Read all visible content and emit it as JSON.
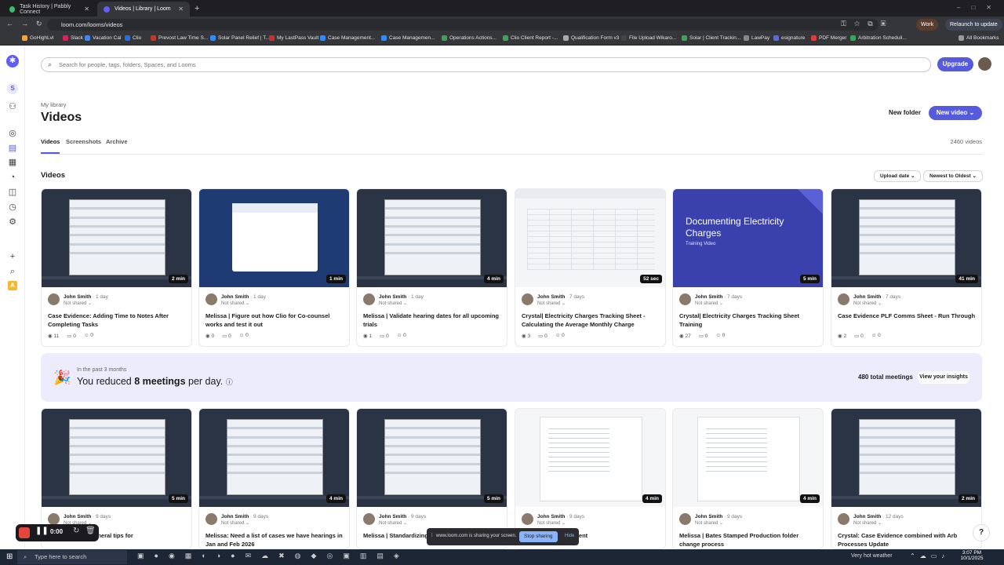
{
  "browser": {
    "tabs": [
      {
        "title": "Task History | Pabbly Connect",
        "color": "#3cba6f"
      },
      {
        "title": "Videos | Library | Loom",
        "color": "#625df5"
      }
    ],
    "url": "loom.com/looms/videos",
    "profile": "Work",
    "relaunch": "Relaunch to update",
    "bookmarks": [
      {
        "label": "GoHighLvl",
        "color": "#f2a53b"
      },
      {
        "label": "Slack",
        "color": "#e01e5a"
      },
      {
        "label": "Vacation Cal",
        "color": "#4285f4"
      },
      {
        "label": "Clio",
        "color": "#1a73e8"
      },
      {
        "label": "Prevost Law Time S...",
        "color": "#c0392b"
      },
      {
        "label": "Solar Panel Relief | T...",
        "color": "#2d8cff"
      },
      {
        "label": "My LastPass Vault",
        "color": "#d32d27"
      },
      {
        "label": "Case Management...",
        "color": "#2d8cff"
      },
      {
        "label": "Case Managemen...",
        "color": "#2d8cff"
      },
      {
        "label": "Operations Actions...",
        "color": "#34a853"
      },
      {
        "label": "Clio Client Report -...",
        "color": "#34a853"
      },
      {
        "label": "Qualification Form v3",
        "color": "#aaaaaa"
      },
      {
        "label": "File Upload Wikaro...",
        "color": "#444444"
      },
      {
        "label": "Solar | Client Trackin...",
        "color": "#34a853"
      },
      {
        "label": "LawPay",
        "color": "#888888"
      },
      {
        "label": "esignature",
        "color": "#5a6bd8"
      },
      {
        "label": "PDF Merger",
        "color": "#e53935"
      },
      {
        "label": "Arbitration Scheduli...",
        "color": "#34a853"
      }
    ],
    "all_bookmarks": "All Bookmarks"
  },
  "header": {
    "search_placeholder": "Search for people, tags, folders, Spaces, and Looms",
    "upgrade": "Upgrade"
  },
  "page": {
    "breadcrumb": "My library",
    "title": "Videos",
    "new_folder": "New folder",
    "new_video": "New video",
    "tabs": [
      "Videos",
      "Screenshots",
      "Archive"
    ],
    "count": "2460 videos",
    "section": "Videos",
    "sort_field": "Upload date",
    "sort_order": "Newest to Oldest"
  },
  "videos": [
    {
      "title": "Case Evidence: Adding Time to Notes After Completing Tasks",
      "author": "John Smith",
      "ago": "1 day",
      "share": "Not shared",
      "duration": "2 min",
      "views": "11",
      "comments": "0",
      "reactions": "0",
      "thumb": "app"
    },
    {
      "title": "Melissa | Figure out how Clio for Co-counsel works and test it out",
      "author": "John Smith",
      "ago": "1 day",
      "share": "Not shared",
      "duration": "1 min",
      "views": "0",
      "comments": "0",
      "reactions": "0",
      "thumb": "blue"
    },
    {
      "title": "Melissa | Validate hearing dates for all upcoming trials",
      "author": "John Smith",
      "ago": "1 day",
      "share": "Not shared",
      "duration": "4 min",
      "views": "1",
      "comments": "0",
      "reactions": "0",
      "thumb": "app"
    },
    {
      "title": "Crystal| Electricity Charges Tracking Sheet - Calculating the Average Monthly Charge",
      "author": "John Smith",
      "ago": "7 days",
      "share": "Not shared",
      "duration": "52 sec",
      "views": "3",
      "comments": "0",
      "reactions": "0",
      "thumb": "sheet"
    },
    {
      "title": "Crystal| Electricity Charges Tracking Sheet Training",
      "author": "John Smith",
      "ago": "7 days",
      "share": "Not shared",
      "duration": "5 min",
      "views": "27",
      "comments": "0",
      "reactions": "0",
      "thumb": "doc",
      "thumb_title": "Documenting Electricity Charges",
      "thumb_sub": "Training Video"
    },
    {
      "title": "Case Evidence PLF Comms Sheet - Run Through",
      "author": "John Smith",
      "ago": "7 days",
      "share": "Not shared",
      "duration": "41 min",
      "views": "2",
      "comments": "0",
      "reactions": "0",
      "thumb": "app"
    }
  ],
  "banner": {
    "sub": "In the past 3 months",
    "pre": "You reduced ",
    "bold": "8 meetings",
    "post": " per day.",
    "total": "480 total meetings",
    "insights": "View your insights"
  },
  "videos2": [
    {
      "title": "...lison about a general tips for",
      "author": "John Smith",
      "ago": "9 days",
      "share": "Not shared",
      "duration": "5 min",
      "thumb": "app"
    },
    {
      "title": "Melissa: Need a list of cases we have hearings in Jan and Feb 2026",
      "author": "John Smith",
      "ago": "9 days",
      "share": "Not shared",
      "duration": "4 min",
      "thumb": "app"
    },
    {
      "title": "Melissa | Standardizing",
      "author": "John Smith",
      "ago": "9 days",
      "share": "Not shared",
      "duration": "5 min",
      "thumb": "app"
    },
    {
      "title": "Mann e-Sign settlement",
      "author": "John Smith",
      "ago": "9 days",
      "share": "Not shared",
      "duration": "4 min",
      "thumb": "page"
    },
    {
      "title": "Melissa | Bates Stamped Production folder change process",
      "author": "John Smith",
      "ago": "9 days",
      "share": "Not shared",
      "duration": "4 min",
      "thumb": "page"
    },
    {
      "title": "Crystal: Case Evidence combined with Arb Processes Update",
      "author": "John Smith",
      "ago": "12 days",
      "share": "Not shared",
      "duration": "2 min",
      "thumb": "app"
    }
  ],
  "recorder": {
    "time": "0:00"
  },
  "sharing": {
    "text": "www.loom.com is sharing your screen.",
    "stop": "Stop sharing",
    "hide": "Hide"
  },
  "taskbar": {
    "search": "Type here to search",
    "weather": "Very hot weather",
    "time": "3:07 PM",
    "date": "10/1/2025"
  }
}
